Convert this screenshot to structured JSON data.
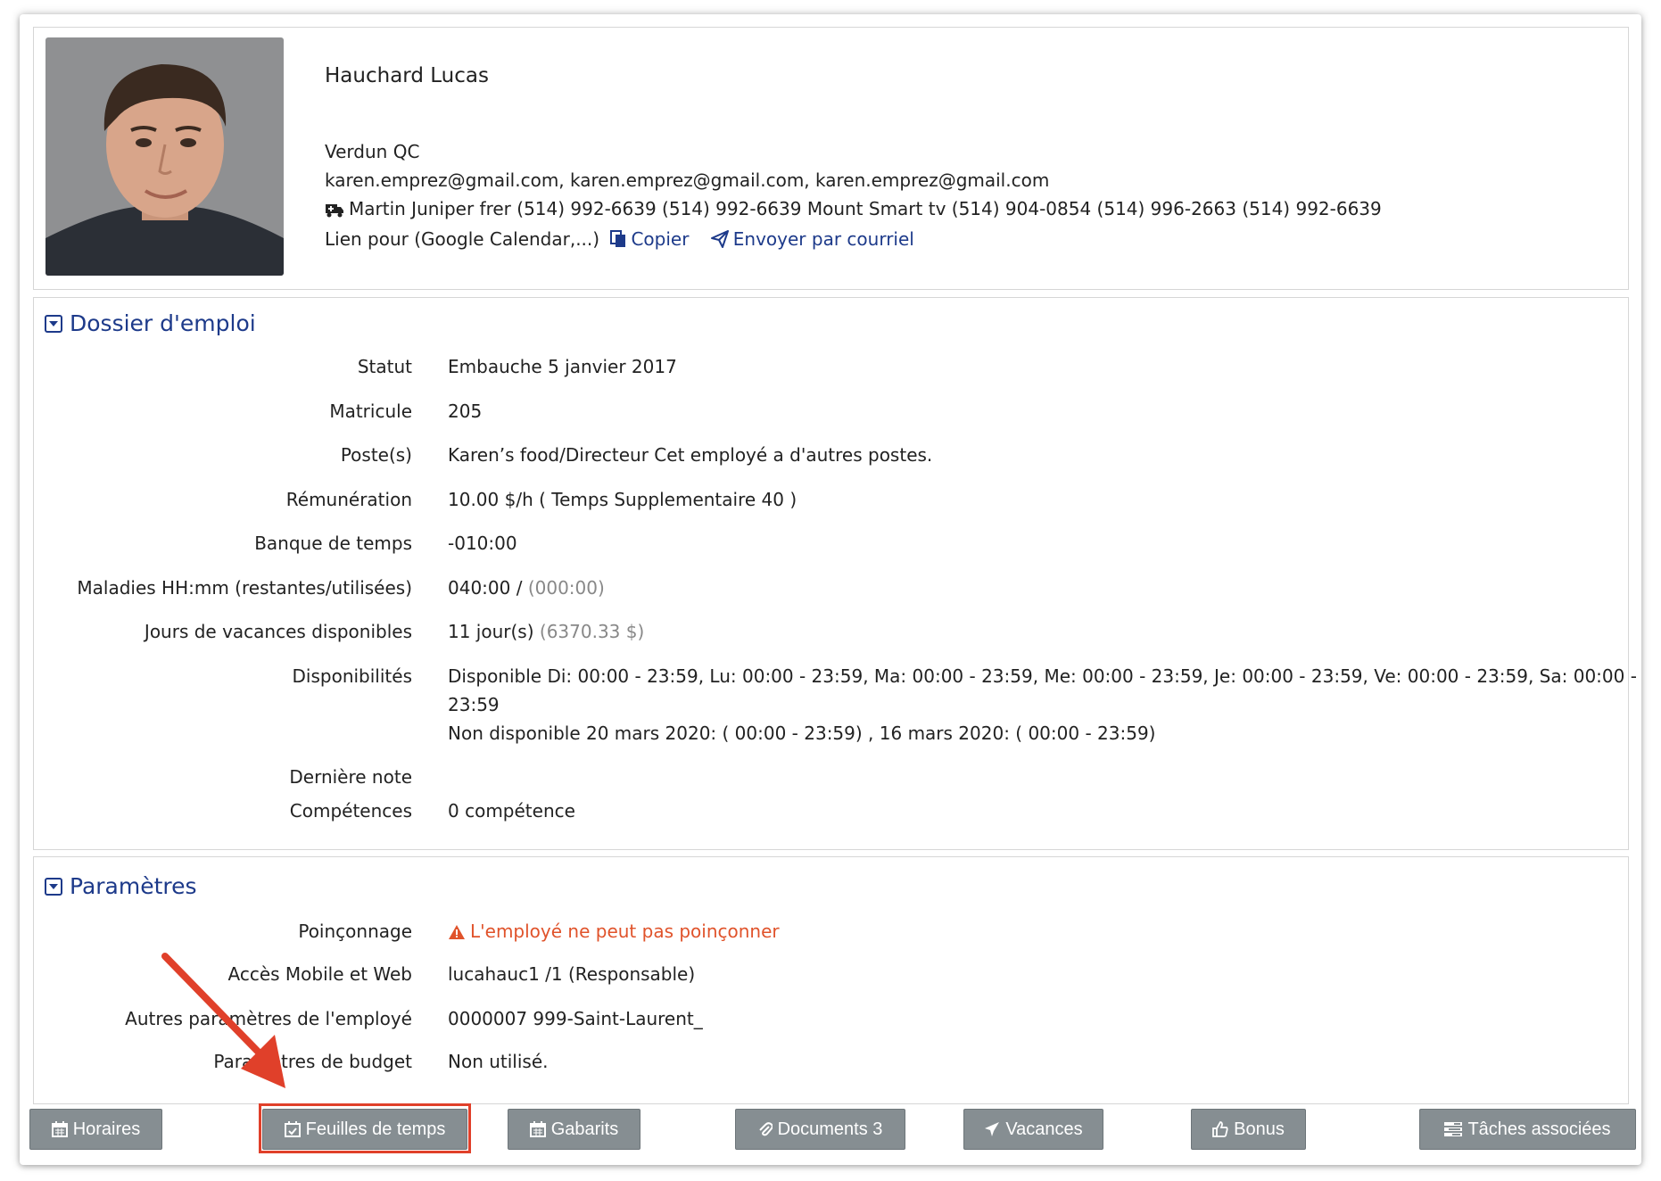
{
  "profile": {
    "name": "Hauchard Lucas",
    "location": "Verdun QC",
    "emails": "karen.emprez@gmail.com, karen.emprez@gmail.com, karen.emprez@gmail.com",
    "emergency_contact": "Martin Juniper frer (514) 992-6639 (514) 992-6639 Mount Smart tv (514) 904-0854 (514) 996-2663 (514) 992-6639",
    "calendar_link_label": "Lien pour (Google Calendar,...)",
    "copy_label": "Copier",
    "email_send_label": "Envoyer par courriel"
  },
  "dossier": {
    "title": "Dossier d'emploi",
    "rows": [
      {
        "label": "Statut",
        "value": "Embauche 5 janvier 2017"
      },
      {
        "label": "Matricule",
        "value": "205"
      },
      {
        "label": "Poste(s)",
        "value": "Karen’s food/Directeur Cet employé a d'autres postes."
      },
      {
        "label": "Rémunération",
        "value": "10.00 $/h ( Temps Supplementaire 40 )"
      },
      {
        "label": "Banque de temps",
        "value": "-010:00"
      },
      {
        "label": "Maladies HH:mm (restantes/utilisées)",
        "value": "040:00 /",
        "value_muted": "(000:00)"
      },
      {
        "label": "Jours de vacances disponibles",
        "value": "11 jour(s)",
        "value_muted": "(6370.33 $)"
      },
      {
        "label": "Disponibilités",
        "value_line1": "Disponible Di: 00:00 - 23:59, Lu: 00:00 - 23:59, Ma: 00:00 - 23:59, Me: 00:00 - 23:59, Je: 00:00 - 23:59, Ve: 00:00 - 23:59, Sa: 00:00 -",
        "value_line2": "23:59",
        "value_line3": "Non disponible 20 mars 2020: ( 00:00 - 23:59) , 16 mars 2020: ( 00:00 - 23:59)"
      },
      {
        "label": "Dernière note",
        "value": ""
      },
      {
        "label": "Compétences",
        "value": "0 compétence"
      }
    ]
  },
  "params": {
    "title": "Paramètres",
    "rows": [
      {
        "label": "Poinçonnage",
        "value": "L'employé ne peut pas poinçonner"
      },
      {
        "label": "Accès Mobile et Web",
        "value": "lucahauc1 /1 (Responsable)"
      },
      {
        "label": "Autres paramètres de l'employé",
        "value": "0000007 999-Saint-Laurent_"
      },
      {
        "label": "Paramètres de budget",
        "value": "Non utilisé."
      }
    ]
  },
  "toolbar": {
    "horaires": "Horaires",
    "feuilles": "Feuilles de temps",
    "gabarits": "Gabarits",
    "documents": "Documents 3",
    "vacances": "Vacances",
    "bonus": "Bonus",
    "taches": "Tâches associées"
  },
  "colors": {
    "accent": "#1d3a8a",
    "warning": "#e0532b",
    "button_bg": "#868e92",
    "highlight": "#e0402a"
  }
}
